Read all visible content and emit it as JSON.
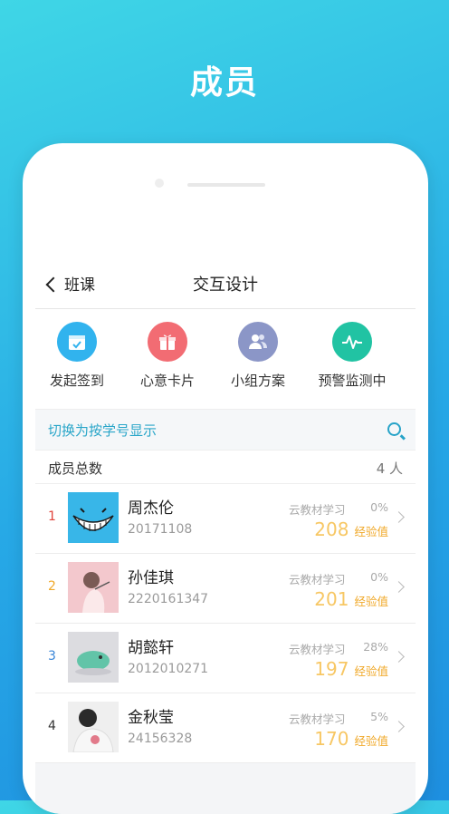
{
  "headline": "成员",
  "nav": {
    "back_label": "班课",
    "title": "交互设计"
  },
  "actions": [
    {
      "label": "发起签到",
      "icon": "calendar-icon",
      "color": "#31b3ee"
    },
    {
      "label": "心意卡片",
      "icon": "gift-icon",
      "color": "#f26c73"
    },
    {
      "label": "小组方案",
      "icon": "group-icon",
      "color": "#8b96c7"
    },
    {
      "label": "预警监测中",
      "icon": "pulse-icon",
      "color": "#21c3a3"
    }
  ],
  "search": {
    "label": "切换为按学号显示",
    "icon": "search-icon"
  },
  "summary": {
    "label": "成员总数",
    "count": "4 人"
  },
  "members": [
    {
      "rank": "1",
      "rank_color": "#e0433b",
      "name": "周杰伦",
      "id": "20171108",
      "course": "云教材学习",
      "percent": "0%",
      "exp": "208",
      "exp_unit": "经验值"
    },
    {
      "rank": "2",
      "rank_color": "#f0a92a",
      "name": "孙佳琪",
      "id": "2220161347",
      "course": "云教材学习",
      "percent": "0%",
      "exp": "201",
      "exp_unit": "经验值"
    },
    {
      "rank": "3",
      "rank_color": "#3a86d8",
      "name": "胡懿轩",
      "id": "2012010271",
      "course": "云教材学习",
      "percent": "28%",
      "exp": "197",
      "exp_unit": "经验值"
    },
    {
      "rank": "4",
      "rank_color": "#333333",
      "name": "金秋莹",
      "id": "24156328",
      "course": "云教材学习",
      "percent": "5%",
      "exp": "170",
      "exp_unit": "经验值"
    }
  ]
}
